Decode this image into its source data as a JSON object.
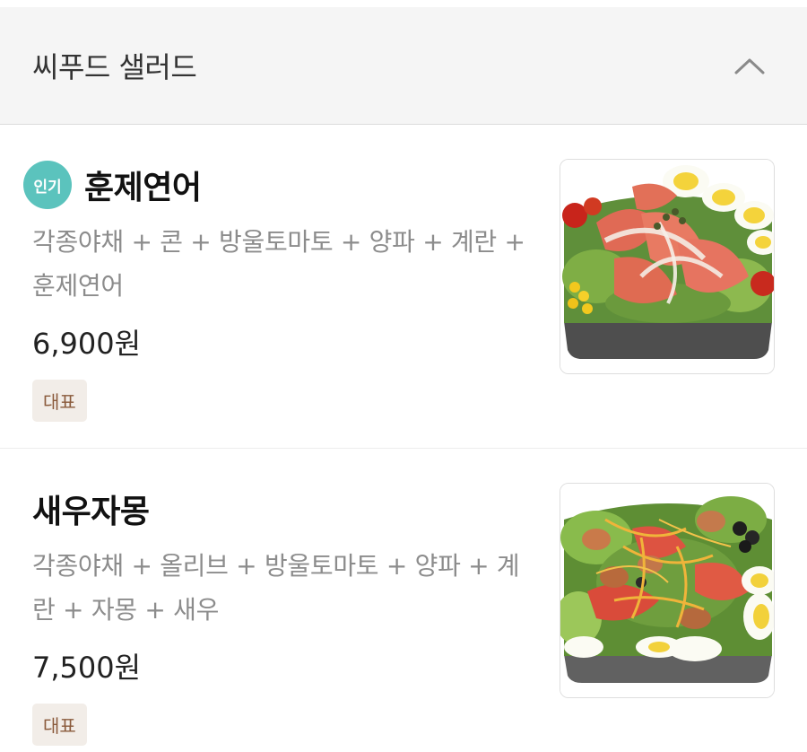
{
  "section": {
    "title": "씨푸드 샐러드"
  },
  "items": [
    {
      "badge": "인기",
      "name": "훈제연어",
      "desc_line1": "각종야채 + 콘 + 방울토마토 + 양파 + 계란 +",
      "desc_line2": "훈제연어",
      "price": "6,900원",
      "tag": "대표"
    },
    {
      "name": "새우자몽",
      "desc_line1": "각종야채 + 올리브 + 방울토마토 + 양파 + 계",
      "desc_line2": "란 + 자몽 + 새우",
      "price": "7,500원",
      "tag": "대표"
    }
  ],
  "colors": {
    "badge_bg": "#5bc3bd",
    "tag_bg": "#f2ede8",
    "tag_text": "#8a5a3b",
    "header_bg": "#f5f5f5"
  },
  "icons": [
    "chevron-up-icon"
  ]
}
